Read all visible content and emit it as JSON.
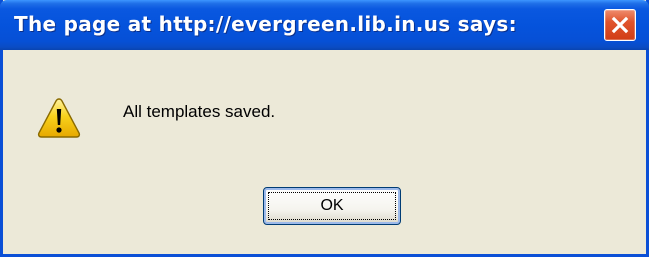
{
  "dialog": {
    "title": "The page at http://evergreen.lib.in.us says:",
    "message": "All templates saved.",
    "ok_label": "OK"
  },
  "icons": {
    "close": "close-icon",
    "warning": "warning-icon"
  },
  "colors": {
    "titlebar": "#0553dc",
    "close_button": "#e0532c",
    "dialog_background": "#ece9d8",
    "warning_yellow": "#f5c800"
  }
}
